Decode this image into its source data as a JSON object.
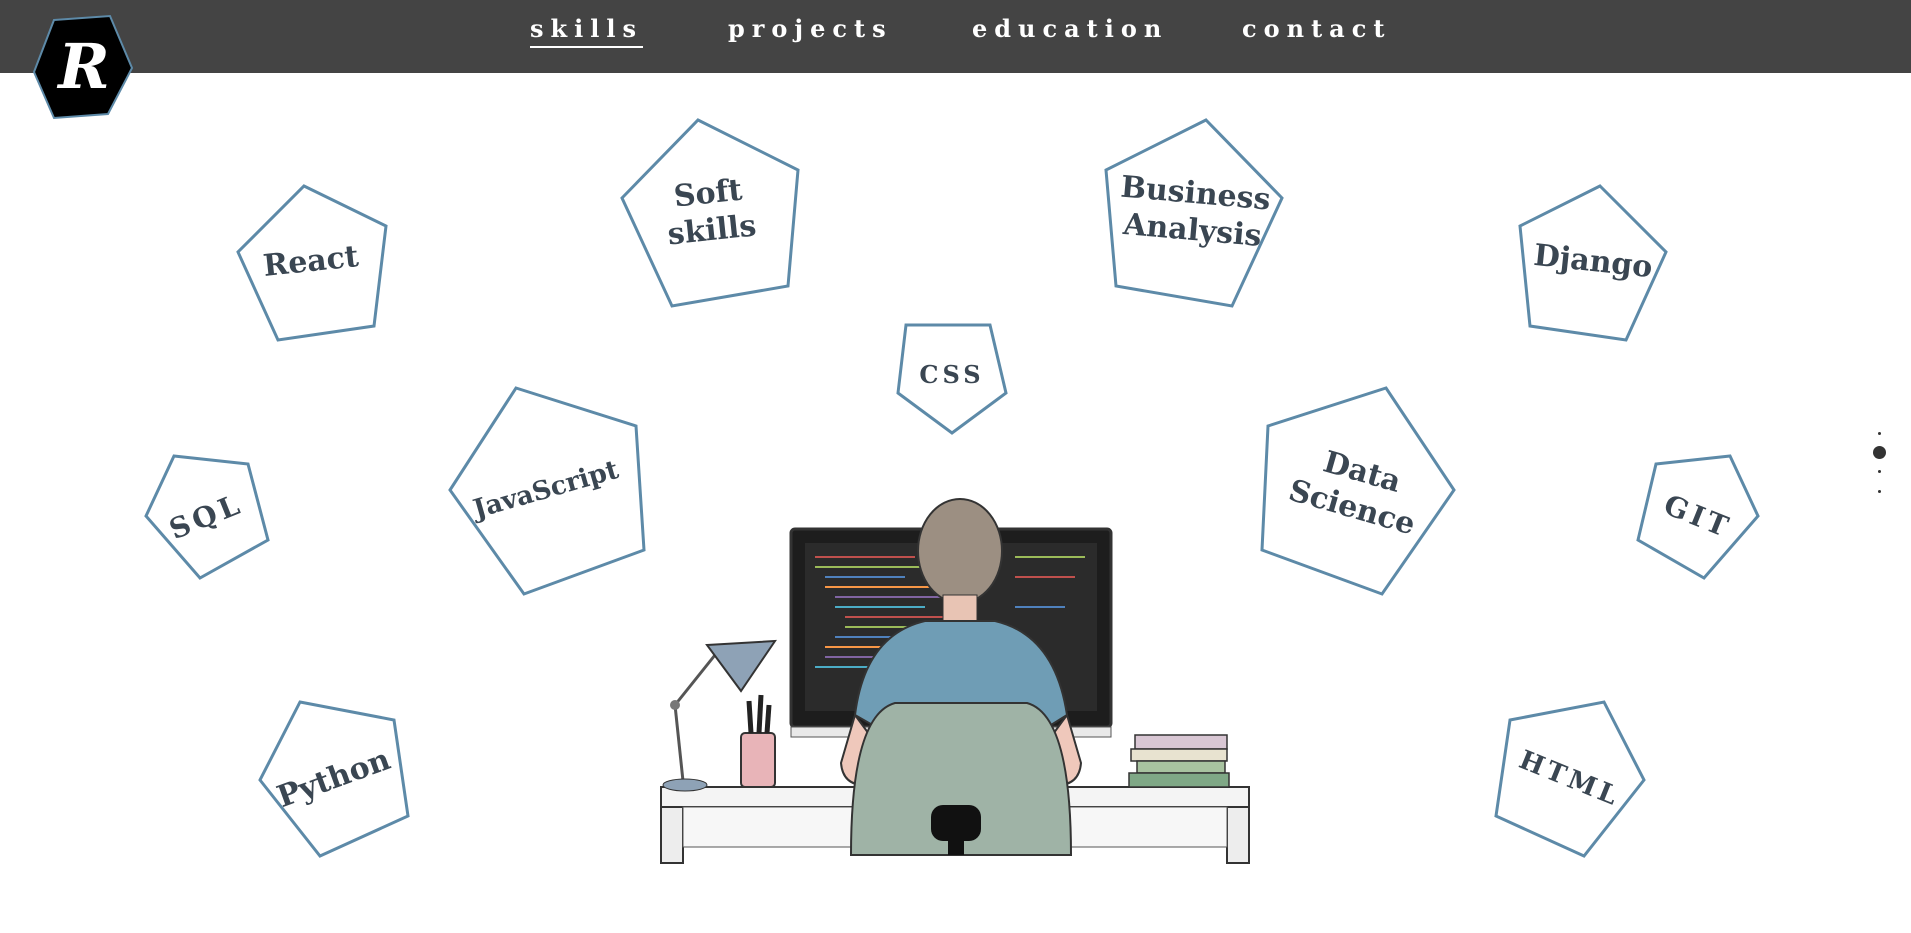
{
  "logo": {
    "letter": "R",
    "icon": "hexagon-logo-icon"
  },
  "nav": {
    "items": [
      {
        "label": "skills",
        "active": true
      },
      {
        "label": "projects",
        "active": false
      },
      {
        "label": "education",
        "active": false
      },
      {
        "label": "contact",
        "active": false
      }
    ]
  },
  "skills": {
    "react": "React",
    "soft_skills": "Soft\nskills",
    "business_analysis": "Business\nAnalysis",
    "django": "Django",
    "css": "CSS",
    "sql": "SQL",
    "javascript": "JavaScript",
    "data_science": "Data\nScience",
    "git": "GIT",
    "python": "Python",
    "html": "HTML"
  },
  "illustration": {
    "icon": "developer-at-desk-illustration"
  },
  "section_nav": {
    "count": 4,
    "active_index": 1
  },
  "colors": {
    "topbar": "#444444",
    "pentagon_stroke": "#5d8aa8",
    "skill_text": "#3a4652",
    "nav_text": "#ffffff"
  }
}
